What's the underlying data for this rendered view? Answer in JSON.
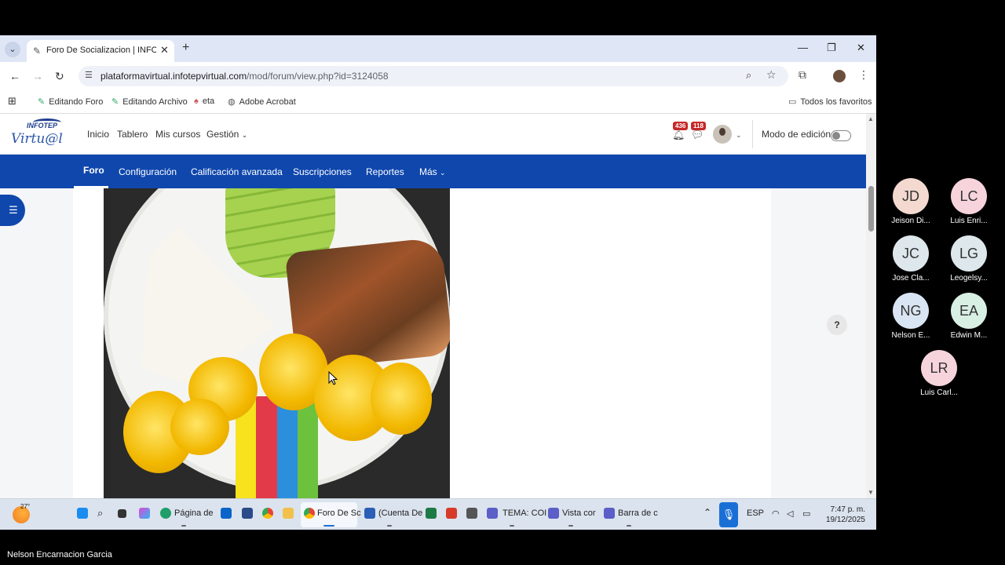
{
  "browser": {
    "tab_title": "Foro De Socializacion | INFOTEP",
    "url_main": "plataformavirtual.infotepvirtual.com",
    "url_path": "/mod/forum/view.php?id=3124058",
    "bookmarks": [
      "Editando Foro",
      "Editando Archivo",
      "eta",
      "Adobe Acrobat"
    ],
    "all_favorites": "Todos los favoritos"
  },
  "logo": {
    "line1": "INFOTEP",
    "line2": "Virtu@l"
  },
  "moodle": {
    "top_nav": [
      "Inicio",
      "Tablero",
      "Mis cursos",
      "Gestión"
    ],
    "notifications_count": "436",
    "messages_count": "118",
    "edit_mode_label": "Modo de edición",
    "edit_mode_on": false,
    "secondary_nav": [
      "Foro",
      "Configuración",
      "Calificación avanzada",
      "Suscripciones",
      "Reportes",
      "Más"
    ],
    "active_secondary": "Foro",
    "help_label": "?"
  },
  "taskbar": {
    "temperature": "27°",
    "items": [
      "Página de",
      "Foro De Sc",
      "(Cuenta De",
      "TEMA: COI",
      "Vista cor",
      "Barra de c"
    ],
    "language": "ESP",
    "time": "7:47 p. m.",
    "date": "19/12/2025"
  },
  "participants": [
    {
      "initials": "JD",
      "name": "Jeison Di...",
      "color": "#f3d9cf"
    },
    {
      "initials": "LC",
      "name": "Luis Enri...",
      "color": "#f7d4dc"
    },
    {
      "initials": "JC",
      "name": "Jose Cla...",
      "color": "#dde7ec"
    },
    {
      "initials": "LG",
      "name": "Leogelsy...",
      "color": "#dde7ec"
    },
    {
      "initials": "NG",
      "name": "Nelson E...",
      "color": "#d9e5f2"
    },
    {
      "initials": "EA",
      "name": "Edwin M...",
      "color": "#d8efe4"
    },
    {
      "initials": "LR",
      "name": "Luis Carl...",
      "color": "#f7d4dc"
    }
  ],
  "presenter_name": "Nelson Encarnacion Garcia"
}
